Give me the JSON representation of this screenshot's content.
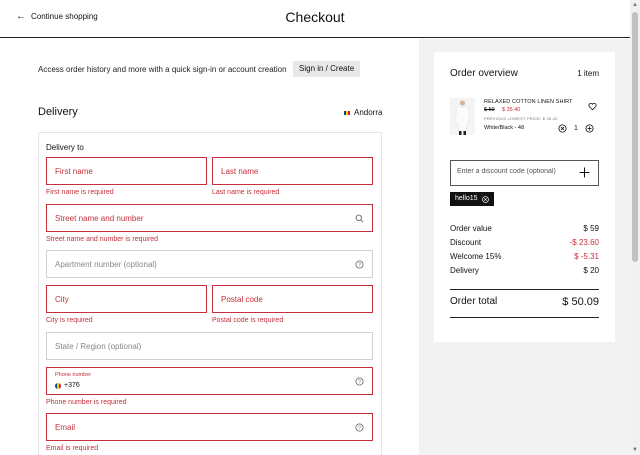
{
  "header": {
    "back_label": "Continue shopping",
    "title": "Checkout"
  },
  "signin": {
    "text": "Access order history and more with a quick sign-in or account creation",
    "button_label": "Sign in / Create"
  },
  "delivery": {
    "title": "Delivery",
    "country": "Andorra",
    "section_label": "Delivery to",
    "fields": {
      "first_name": {
        "placeholder": "First name",
        "error": "First name is required"
      },
      "last_name": {
        "placeholder": "Last name",
        "error": "Last name is required"
      },
      "street": {
        "placeholder": "Street name and number",
        "error": "Street name and number is required"
      },
      "apartment": {
        "placeholder": "Apartment number (optional)"
      },
      "city": {
        "placeholder": "City",
        "error": "City is required"
      },
      "postal": {
        "placeholder": "Postal code",
        "error": "Postal code is required"
      },
      "state": {
        "placeholder": "State / Region (optional)"
      },
      "phone": {
        "label": "Phone number",
        "prefix": "+376",
        "error": "Phone number is required"
      },
      "email": {
        "placeholder": "Email",
        "error": "Email is required"
      }
    }
  },
  "overview": {
    "title": "Order overview",
    "count": "1 item",
    "product": {
      "name": "RELAXED COTTON LINEN SHIRT",
      "old_price": "$ 59",
      "new_price": "$ 35.40",
      "previous_lowest": "PREVIOUS LOWEST PRICE: $ 35.40",
      "variant": "White/Black - 48",
      "quantity": "1"
    },
    "discount_placeholder": "Enter a discount code (optional)",
    "applied_code": "hello15",
    "rows": [
      {
        "label": "Order value",
        "value": "$ 59"
      },
      {
        "label": "Discount",
        "value": "-$ 23.60"
      },
      {
        "label": "Welcome 15%",
        "value": "$ -5.31"
      },
      {
        "label": "Delivery",
        "value": "$ 20"
      }
    ],
    "total_label": "Order total",
    "total_value": "$ 50.09"
  },
  "colors": {
    "error": "#c4303b",
    "panel_bg": "#f2f2f2",
    "text": "#111111"
  }
}
